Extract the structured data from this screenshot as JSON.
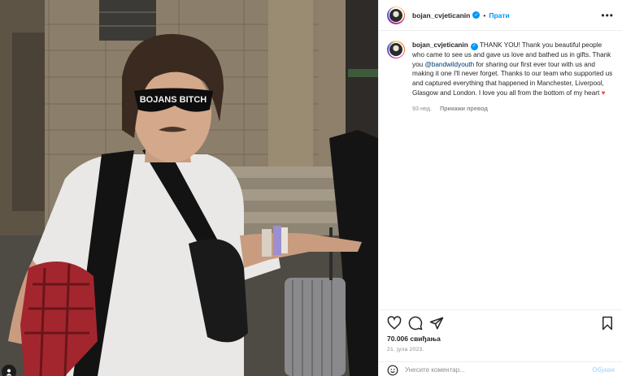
{
  "post": {
    "username": "bojan_cvjeticanin",
    "follow_label": "Прати",
    "dot": "•",
    "more_label": "•••",
    "caption": {
      "username": "bojan_cvjeticanin",
      "text_before": "THANK YOU! Thank you beautiful people who came to see us and gave us love and bathed us in gifts. Thank you",
      "mention": "@bandwildyouth",
      "text_after": "for sharing our first ever tour with us and making it one I'll never forget. Thanks to our team who supported us and captured everything that happened in Manchester, Liverpool, Glasgow and London. I love you all from the bottom of my heart",
      "heart": "♥"
    },
    "time_ago": "93 нед.",
    "translate_label": "Прикажи превод",
    "likes": "70.006 свиђања",
    "date": "21. јула 2023.",
    "comment_placeholder": "Унесите коментар...",
    "post_button": "Објави"
  },
  "photo": {
    "glasses_text": "BOJANS BITCH"
  },
  "icons": {
    "verified": "verified-badge-icon",
    "like": "heart-icon",
    "comment": "comment-icon",
    "share": "paper-plane-icon",
    "save": "bookmark-icon",
    "emoji": "smiley-icon",
    "tag": "user-tag-icon",
    "next": "chevron-right-icon"
  },
  "colors": {
    "accent": "#0095f6",
    "mention": "#00376b",
    "heart": "#ed4956",
    "muted": "#8e8e8e"
  }
}
